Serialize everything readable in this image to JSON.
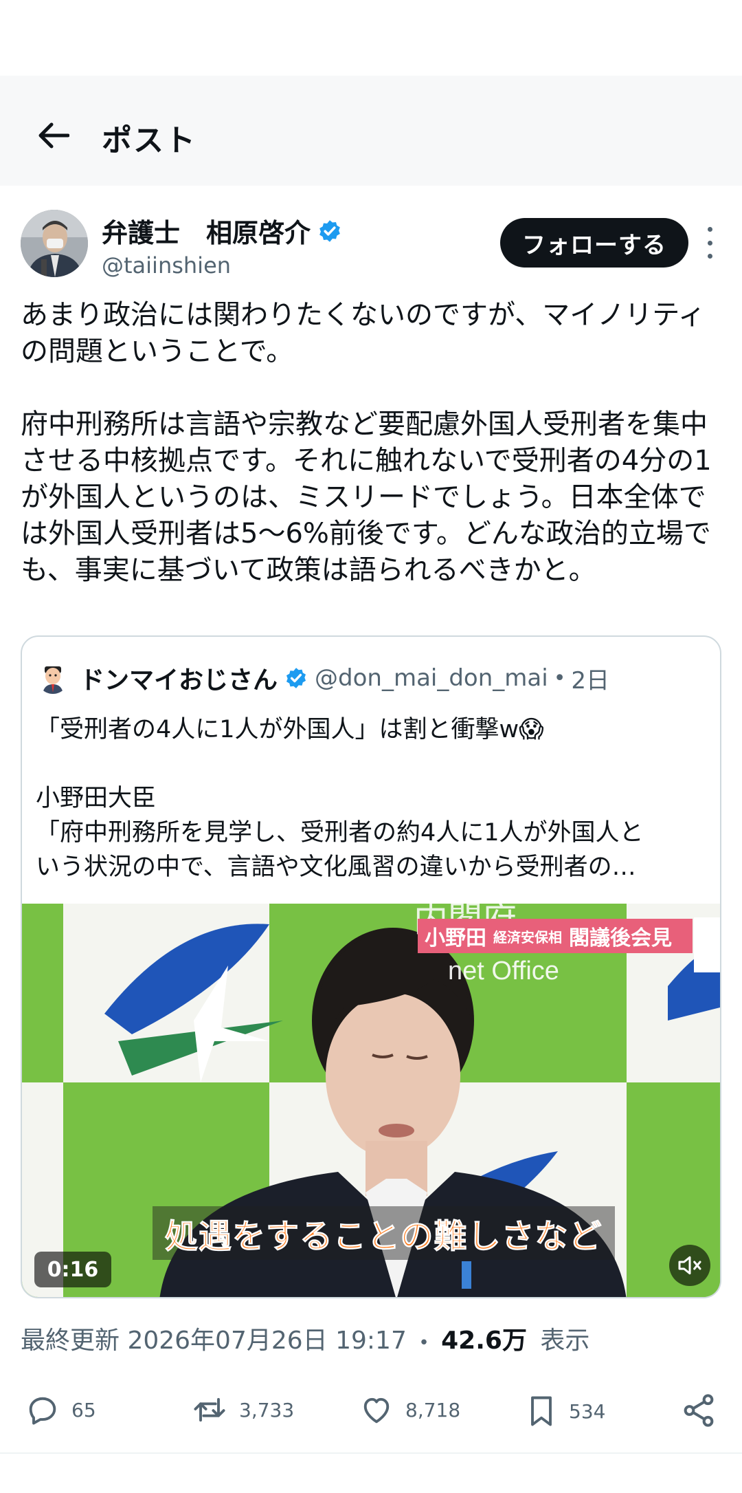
{
  "header": {
    "title": "ポスト",
    "back_icon": "arrow-left-icon"
  },
  "author": {
    "name": "弁護士　相原啓介",
    "handle": "@taiinshien",
    "verified": true,
    "follow_label": "フォローする"
  },
  "post": {
    "paragraphs": [
      "あまり政治には関わりたくないのですが、マイノリティの問題ということで。",
      "府中刑務所は言語や宗教など要配慮外国人受刑者を集中させる中核拠点です。それに触れないで受刑者の4分の1が外国人というのは、ミスリードでしょう。日本全体では外国人受刑者は5〜6%前後です。どんな政治的立場でも、事実に基づいて政策は語られるべきかと。"
    ]
  },
  "quote": {
    "name": "ドンマイおじさん",
    "handle": "@don_mai_don_mai",
    "separator": "•",
    "time": "2日",
    "line1": "「受刑者の4人に1人が外国人」は割と衝撃w😱",
    "line2": "小野田大臣",
    "line3": "「府中刑務所を見学し、受刑者の約4人に1人が外国人と",
    "line4": "いう状況の中で、言語や文化風習の違いから受刑者の…",
    "video": {
      "caption_name": "小野田",
      "caption_role": "経済安保相",
      "caption_event": "閣議後会見",
      "subtitle": "処遇をすることの難しさなど",
      "duration": "0:16",
      "backdrop_text_1": "内閣府",
      "backdrop_text_2": "net Office"
    }
  },
  "meta": {
    "prefix": "最終更新 2026年07月26日 19:17",
    "dot": "•",
    "views": "42.6万",
    "views_suffix": "表示"
  },
  "actions": {
    "replies": "65",
    "reposts": "3,733",
    "likes": "8,718",
    "bookmarks": "534"
  },
  "colors": {
    "verified": "#1d9bf0",
    "text": "#0f1419",
    "muted": "#536471",
    "follow_bg": "#0f1419"
  }
}
